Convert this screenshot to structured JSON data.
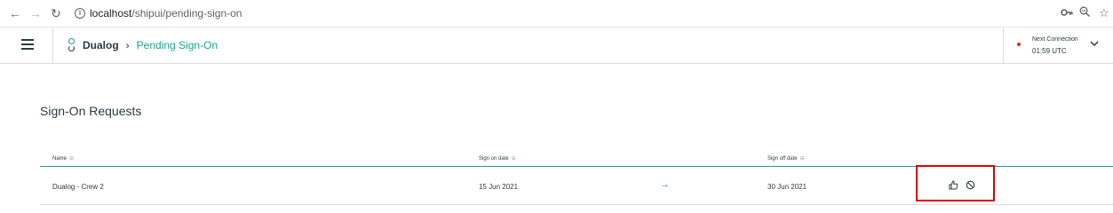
{
  "browser": {
    "back_icon": "arrow-left-icon",
    "forward_icon": "arrow-right-icon",
    "reload_icon": "reload-icon",
    "url_host": "localhost",
    "url_path": "/shipui/pending-sign-on",
    "key_icon": "key-icon",
    "zoom_icon": "zoom-icon",
    "star_icon": "star-icon"
  },
  "header": {
    "app_name": "Dualog",
    "separator": "›",
    "page_name": "Pending Sign-On",
    "connection": {
      "label": "Next Connection",
      "time": "01:59 UTC",
      "status_color": "#e02b2b"
    }
  },
  "main": {
    "title": "Sign-On Requests",
    "columns": [
      {
        "label": "Name"
      },
      {
        "label": "Sign on date"
      },
      {
        "label": "Sign off date"
      }
    ],
    "rows": [
      {
        "name": "Dualog - Crew 2",
        "sign_on": "15 Jun 2021",
        "sign_off": "30 Jun 2021",
        "arrow": "→",
        "actions": [
          "thumbs-up-icon",
          "block-icon"
        ]
      }
    ]
  },
  "colors": {
    "accent": "#1aa38e",
    "text": "#2b3a42",
    "highlight_box": "#e00000"
  }
}
